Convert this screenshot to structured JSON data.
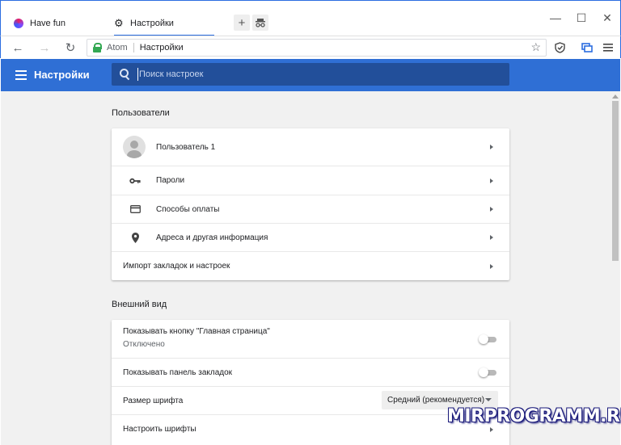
{
  "tabs": [
    {
      "label": "Have fun",
      "icon": "fun-icon"
    },
    {
      "label": "Настройки",
      "icon": "gear-icon"
    }
  ],
  "window_controls": {
    "minimize": "—",
    "maximize": "☐",
    "close": "✕"
  },
  "toolbar": {
    "back": "←",
    "forward": "→",
    "reload": "↻",
    "site_name": "Atom",
    "address": "Настройки",
    "star": "☆"
  },
  "header": {
    "title": "Настройки",
    "search_placeholder": "Поиск настроек"
  },
  "sections": {
    "users": {
      "title": "Пользователи",
      "profile_name": "Пользователь 1",
      "passwords": "Пароли",
      "payment": "Способы оплаты",
      "addresses": "Адреса и другая информация",
      "import": "Импорт закладок и настроек"
    },
    "appearance": {
      "title": "Внешний вид",
      "home_button": "Показывать кнопку \"Главная страница\"",
      "home_button_status": "Отключено",
      "bookmarks_bar": "Показывать панель закладок",
      "font_size": "Размер шрифта",
      "font_size_value": "Средний (рекомендуется)",
      "customize_fonts": "Настроить шрифты"
    }
  },
  "toggles": {
    "home_button_on": false,
    "bookmarks_bar_on": false
  },
  "colors": {
    "accent": "#2f6fd5",
    "search_bg": "#224f9a",
    "secure": "#34a853"
  },
  "watermark": "MIRPROGRAMM.RU"
}
